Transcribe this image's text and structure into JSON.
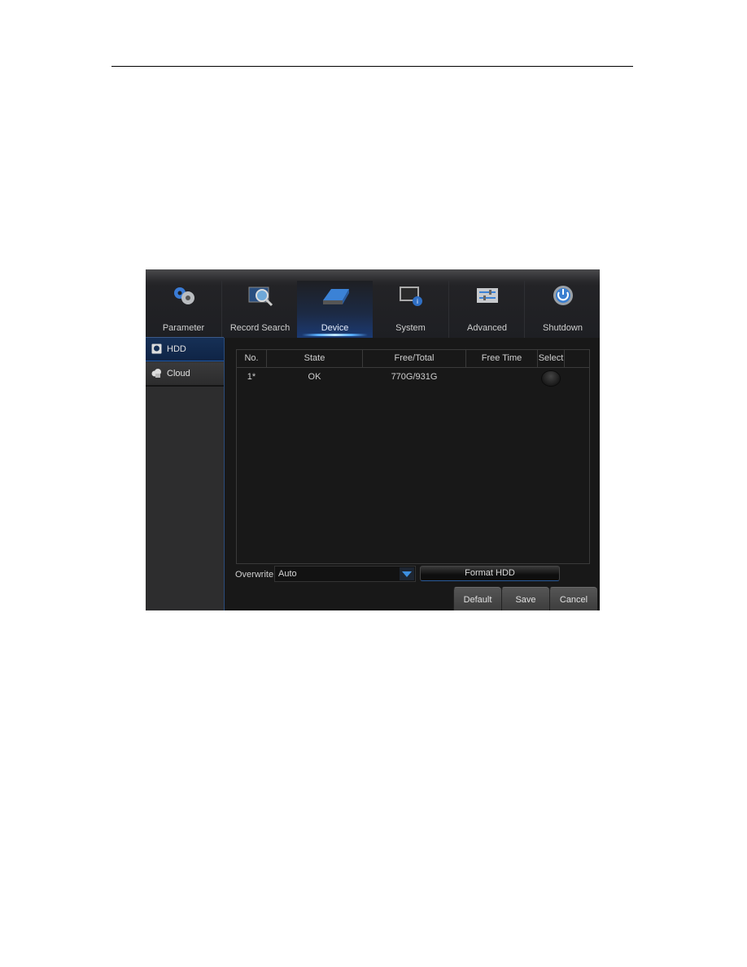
{
  "topnav": {
    "tabs": [
      {
        "label": "Parameter",
        "icon": "gears-icon"
      },
      {
        "label": "Record Search",
        "icon": "film-magnifier-icon"
      },
      {
        "label": "Device",
        "icon": "hard-drive-icon",
        "active": true
      },
      {
        "label": "System",
        "icon": "monitor-info-icon"
      },
      {
        "label": "Advanced",
        "icon": "sliders-icon"
      },
      {
        "label": "Shutdown",
        "icon": "power-icon"
      }
    ]
  },
  "sidebar": {
    "items": [
      {
        "label": "HDD",
        "icon": "hdd-icon",
        "active": true
      },
      {
        "label": "Cloud",
        "icon": "cloud-icon"
      }
    ]
  },
  "table": {
    "columns": [
      "No.",
      "State",
      "Free/Total",
      "Free Time",
      "Select"
    ],
    "rows": [
      {
        "no": "1*",
        "state": "OK",
        "free_total": "770G/931G",
        "free_time": "",
        "selected": false
      }
    ]
  },
  "overwrite": {
    "label": "Overwrite",
    "value": "Auto"
  },
  "buttons": {
    "format": "Format HDD",
    "default": "Default",
    "save": "Save",
    "cancel": "Cancel"
  },
  "colors": {
    "accent": "#1f5aa8",
    "panel_bg": "#181818",
    "sidebar_bg": "#2d2d2e"
  }
}
